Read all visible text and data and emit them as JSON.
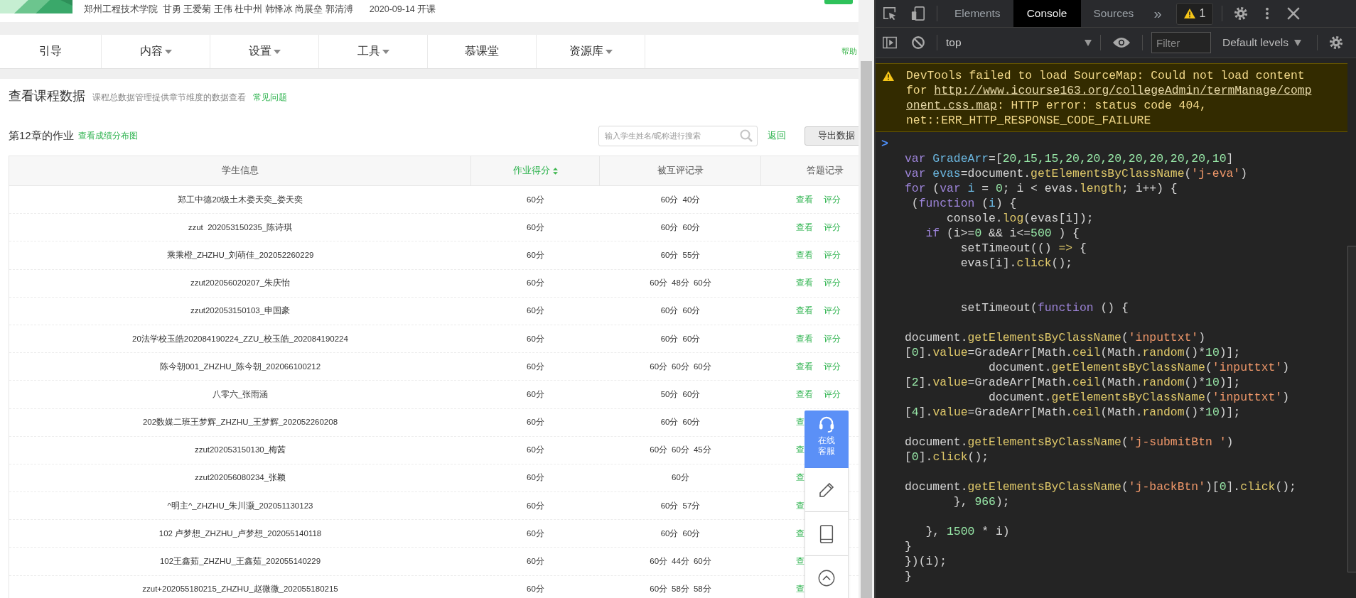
{
  "page": {
    "header": {
      "school": "郑州工程技术学院",
      "teachers": "甘勇 王爱菊 王伟 杜中州 韩怿冰 尚展垒 郭清溥",
      "date": "2020-09-14 开课"
    },
    "nav": {
      "items": [
        {
          "label": "引导",
          "has_menu": false
        },
        {
          "label": "内容",
          "has_menu": true
        },
        {
          "label": "设置",
          "has_menu": true
        },
        {
          "label": "工具",
          "has_menu": true
        },
        {
          "label": "慕课堂",
          "has_menu": false
        },
        {
          "label": "资源库",
          "has_menu": true
        }
      ],
      "help": "帮助"
    },
    "title": "查看课程数据",
    "subtitle": "课程总数据管理提供章节维度的数据查看",
    "faq_link": "常见问题",
    "section": {
      "title": "第12章的作业",
      "link": "查看成绩分布图",
      "search": {
        "placeholder": "输入学生姓名/昵称进行搜索"
      },
      "back_link": "返回",
      "export_button": "导出数据"
    },
    "table": {
      "columns": [
        {
          "label": "学生信息",
          "sorted": false
        },
        {
          "label": "作业得分",
          "sorted": true
        },
        {
          "label": "被互评记录",
          "sorted": false
        },
        {
          "label": "答题记录",
          "sorted": false
        }
      ],
      "rows": [
        {
          "student": "郑工中德20级土木娄天奕_娄天奕",
          "score": "60分",
          "peer_scores": [
            "60分",
            "40分"
          ],
          "actions": [
            "查看",
            "评分"
          ]
        },
        {
          "student": "zzut  202053150235_陈诗琪",
          "score": "60分",
          "peer_scores": [
            "60分",
            "60分"
          ],
          "actions": [
            "查看",
            "评分"
          ]
        },
        {
          "student": "乘乘橙_ZHZHU_刘萌佳_202052260229",
          "score": "60分",
          "peer_scores": [
            "60分",
            "55分"
          ],
          "actions": [
            "查看",
            "评分"
          ]
        },
        {
          "student": "zzut202056020207_朱庆怡",
          "score": "60分",
          "peer_scores": [
            "60分",
            "48分",
            "60分"
          ],
          "actions": [
            "查看",
            "评分"
          ]
        },
        {
          "student": "zzut202053150103_申国豪",
          "score": "60分",
          "peer_scores": [
            "60分",
            "60分"
          ],
          "actions": [
            "查看",
            "评分"
          ]
        },
        {
          "student": "20法学校玉皓202084190224_ZZU_校玉皓_202084190224",
          "score": "60分",
          "peer_scores": [
            "60分",
            "60分"
          ],
          "actions": [
            "查看",
            "评分"
          ]
        },
        {
          "student": "陈今朝001_ZHZHU_陈今朝_202066100212",
          "score": "60分",
          "peer_scores": [
            "60分",
            "60分",
            "60分"
          ],
          "actions": [
            "查看",
            "评分"
          ]
        },
        {
          "student": "八零六_张雨涵",
          "score": "60分",
          "peer_scores": [
            "50分",
            "60分"
          ],
          "actions": [
            "查看",
            "评分"
          ]
        },
        {
          "student": "202数媒二班王梦辉_ZHZHU_王梦辉_202052260208",
          "score": "60分",
          "peer_scores": [
            "60分",
            "60分"
          ],
          "actions": [
            "查"
          ]
        },
        {
          "student": "zzut202053150130_梅茜",
          "score": "60分",
          "peer_scores": [
            "60分",
            "60分",
            "45分"
          ],
          "actions": [
            "查"
          ]
        },
        {
          "student": "zzut202056080234_张颖",
          "score": "60分",
          "peer_scores": [
            "60分"
          ],
          "actions": [
            "查"
          ]
        },
        {
          "student": "^明主^_ZHZHU_朱川灏_202051130123",
          "score": "60分",
          "peer_scores": [
            "60分",
            "57分"
          ],
          "actions": [
            "查"
          ]
        },
        {
          "student": "102 卢梦想_ZHZHU_卢梦想_202055140118",
          "score": "60分",
          "peer_scores": [
            "60分",
            "60分"
          ],
          "actions": [
            "查"
          ]
        },
        {
          "student": "102王鑫茹_ZHZHU_王鑫茹_202055140229",
          "score": "60分",
          "peer_scores": [
            "60分",
            "44分",
            "60分"
          ],
          "actions": [
            "查"
          ]
        },
        {
          "student": "zzut+202055180215_ZHZHU_赵微微_202055180215",
          "score": "60分",
          "peer_scores": [
            "60分",
            "58分",
            "58分"
          ],
          "actions": [
            "查"
          ]
        }
      ]
    },
    "float_panel": {
      "service_label": "在线客服"
    }
  },
  "devtools": {
    "tabs": [
      {
        "label": "Elements",
        "selected": false
      },
      {
        "label": "Console",
        "selected": true
      },
      {
        "label": "Sources",
        "selected": false
      }
    ],
    "more": "»",
    "warning_count": "1",
    "context": "top",
    "filter": {
      "placeholder": "Filter"
    },
    "levels": "Default levels",
    "messages": [
      {
        "kind": "warning",
        "text_before": "DevTools failed to load SourceMap: Could not load content for ",
        "link_lines": [
          "http://www.icourse163.org/collegeAdmin/termManage/comp",
          "onent.css.map"
        ],
        "text_after": ": HTTP error: status code 404, net::ERR_HTTP_RESPONSE_CODE_FAILURE"
      }
    ],
    "prompt": ">",
    "code": [
      {
        "kind": "code",
        "tokens": [
          {
            "t": "var ",
            "kind": "kw"
          },
          {
            "t": "GradeArr",
            "kind": "var"
          },
          {
            "t": "=[",
            "kind": "p"
          },
          {
            "t": "20,15,15,20,20,20,20,20,20,20,10",
            "kind": "num"
          },
          {
            "t": "]",
            "kind": "p"
          }
        ]
      },
      {
        "kind": "code",
        "tokens": [
          {
            "t": "var ",
            "kind": "kw"
          },
          {
            "t": "evas",
            "kind": "var"
          },
          {
            "t": "=document.",
            "kind": "p"
          },
          {
            "t": "getElementsByClassName",
            "kind": "fn"
          },
          {
            "t": "(",
            "kind": "p"
          },
          {
            "t": "'j-eva'",
            "kind": "str"
          },
          {
            "t": ")",
            "kind": "p"
          }
        ]
      },
      {
        "kind": "code",
        "tokens": [
          {
            "t": "for",
            "kind": "kw"
          },
          {
            "t": " (",
            "kind": "p"
          },
          {
            "t": "var ",
            "kind": "kw"
          },
          {
            "t": "i",
            "kind": "var"
          },
          {
            "t": " = ",
            "kind": "p"
          },
          {
            "t": "0",
            "kind": "num"
          },
          {
            "t": "; i < evas.",
            "kind": "p"
          },
          {
            "t": "length",
            "kind": "fn"
          },
          {
            "t": "; i++) {",
            "kind": "p"
          }
        ]
      },
      {
        "kind": "code",
        "tokens": [
          {
            "t": " (",
            "kind": "p"
          },
          {
            "t": "function",
            "kind": "kw"
          },
          {
            "t": " (",
            "kind": "p"
          },
          {
            "t": "i",
            "kind": "var"
          },
          {
            "t": ") {",
            "kind": "p"
          }
        ]
      },
      {
        "kind": "code",
        "tokens": [
          {
            "t": "      console.",
            "kind": "p"
          },
          {
            "t": "log",
            "kind": "fn"
          },
          {
            "t": "(evas[i]);",
            "kind": "p"
          }
        ]
      },
      {
        "kind": "code",
        "tokens": [
          {
            "t": "   if",
            "kind": "kw"
          },
          {
            "t": " (i>=",
            "kind": "p"
          },
          {
            "t": "0",
            "kind": "num"
          },
          {
            "t": " && i<=",
            "kind": "p"
          },
          {
            "t": "500",
            "kind": "num"
          },
          {
            "t": " ) {",
            "kind": "p"
          }
        ]
      },
      {
        "kind": "code",
        "tokens": [
          {
            "t": "        setTimeout(() ",
            "kind": "p"
          },
          {
            "t": "=>",
            "kind": "fn"
          },
          {
            "t": " {",
            "kind": "p"
          }
        ]
      },
      {
        "kind": "code",
        "tokens": [
          {
            "t": "        evas[i].",
            "kind": "p"
          },
          {
            "t": "click",
            "kind": "fn"
          },
          {
            "t": "();",
            "kind": "p"
          }
        ]
      },
      {
        "kind": "blank"
      },
      {
        "kind": "blank"
      },
      {
        "kind": "code",
        "tokens": [
          {
            "t": "        setTimeout(",
            "kind": "p"
          },
          {
            "t": "function",
            "kind": "kw"
          },
          {
            "t": " () {",
            "kind": "p"
          }
        ]
      },
      {
        "kind": "blank"
      },
      {
        "kind": "code",
        "tokens": [
          {
            "t": "document.",
            "kind": "p"
          },
          {
            "t": "getElementsByClassName",
            "kind": "fn"
          },
          {
            "t": "(",
            "kind": "p"
          },
          {
            "t": "'inputtxt'",
            "kind": "str"
          },
          {
            "t": ")",
            "kind": "p"
          }
        ]
      },
      {
        "kind": "code",
        "tokens": [
          {
            "t": "[",
            "kind": "p"
          },
          {
            "t": "0",
            "kind": "num"
          },
          {
            "t": "].",
            "kind": "p"
          },
          {
            "t": "value",
            "kind": "fn"
          },
          {
            "t": "=GradeArr[Math.",
            "kind": "p"
          },
          {
            "t": "ceil",
            "kind": "fn"
          },
          {
            "t": "(Math.",
            "kind": "p"
          },
          {
            "t": "random",
            "kind": "fn"
          },
          {
            "t": "()*",
            "kind": "p"
          },
          {
            "t": "10",
            "kind": "num"
          },
          {
            "t": ")];",
            "kind": "p"
          }
        ]
      },
      {
        "kind": "code",
        "tokens": [
          {
            "t": "            document.",
            "kind": "p"
          },
          {
            "t": "getElementsByClassName",
            "kind": "fn"
          },
          {
            "t": "(",
            "kind": "p"
          },
          {
            "t": "'inputtxt'",
            "kind": "str"
          },
          {
            "t": ")",
            "kind": "p"
          }
        ]
      },
      {
        "kind": "code",
        "tokens": [
          {
            "t": "[",
            "kind": "p"
          },
          {
            "t": "2",
            "kind": "num"
          },
          {
            "t": "].",
            "kind": "p"
          },
          {
            "t": "value",
            "kind": "fn"
          },
          {
            "t": "=GradeArr[Math.",
            "kind": "p"
          },
          {
            "t": "ceil",
            "kind": "fn"
          },
          {
            "t": "(Math.",
            "kind": "p"
          },
          {
            "t": "random",
            "kind": "fn"
          },
          {
            "t": "()*",
            "kind": "p"
          },
          {
            "t": "10",
            "kind": "num"
          },
          {
            "t": ")];",
            "kind": "p"
          }
        ]
      },
      {
        "kind": "code",
        "tokens": [
          {
            "t": "            document.",
            "kind": "p"
          },
          {
            "t": "getElementsByClassName",
            "kind": "fn"
          },
          {
            "t": "(",
            "kind": "p"
          },
          {
            "t": "'inputtxt'",
            "kind": "str"
          },
          {
            "t": ")",
            "kind": "p"
          }
        ]
      },
      {
        "kind": "code",
        "tokens": [
          {
            "t": "[",
            "kind": "p"
          },
          {
            "t": "4",
            "kind": "num"
          },
          {
            "t": "].",
            "kind": "p"
          },
          {
            "t": "value",
            "kind": "fn"
          },
          {
            "t": "=GradeArr[Math.",
            "kind": "p"
          },
          {
            "t": "ceil",
            "kind": "fn"
          },
          {
            "t": "(Math.",
            "kind": "p"
          },
          {
            "t": "random",
            "kind": "fn"
          },
          {
            "t": "()*",
            "kind": "p"
          },
          {
            "t": "10",
            "kind": "num"
          },
          {
            "t": ")];",
            "kind": "p"
          }
        ]
      },
      {
        "kind": "blank"
      },
      {
        "kind": "code",
        "tokens": [
          {
            "t": "document.",
            "kind": "p"
          },
          {
            "t": "getElementsByClassName",
            "kind": "fn"
          },
          {
            "t": "(",
            "kind": "p"
          },
          {
            "t": "'j-submitBtn '",
            "kind": "str"
          },
          {
            "t": ")",
            "kind": "p"
          }
        ]
      },
      {
        "kind": "code",
        "tokens": [
          {
            "t": "[",
            "kind": "p"
          },
          {
            "t": "0",
            "kind": "num"
          },
          {
            "t": "].",
            "kind": "p"
          },
          {
            "t": "click",
            "kind": "fn"
          },
          {
            "t": "();",
            "kind": "p"
          }
        ]
      },
      {
        "kind": "blank"
      },
      {
        "kind": "code",
        "tokens": [
          {
            "t": "document.",
            "kind": "p"
          },
          {
            "t": "getElementsByClassName",
            "kind": "fn"
          },
          {
            "t": "(",
            "kind": "p"
          },
          {
            "t": "'j-backBtn'",
            "kind": "str"
          },
          {
            "t": ")[",
            "kind": "p"
          },
          {
            "t": "0",
            "kind": "num"
          },
          {
            "t": "].",
            "kind": "p"
          },
          {
            "t": "click",
            "kind": "fn"
          },
          {
            "t": "();",
            "kind": "p"
          }
        ]
      },
      {
        "kind": "code",
        "tokens": [
          {
            "t": "       }, ",
            "kind": "p"
          },
          {
            "t": "966",
            "kind": "num"
          },
          {
            "t": ");",
            "kind": "p"
          }
        ]
      },
      {
        "kind": "blank"
      },
      {
        "kind": "code",
        "tokens": [
          {
            "t": "   }, ",
            "kind": "p"
          },
          {
            "t": "1500",
            "kind": "num"
          },
          {
            "t": " * i)",
            "kind": "p"
          }
        ]
      },
      {
        "kind": "code",
        "tokens": [
          {
            "t": "}",
            "kind": "p"
          }
        ]
      },
      {
        "kind": "code",
        "tokens": [
          {
            "t": "})(i);",
            "kind": "p"
          }
        ]
      },
      {
        "kind": "code",
        "tokens": [
          {
            "t": "}",
            "kind": "p"
          }
        ]
      }
    ]
  }
}
